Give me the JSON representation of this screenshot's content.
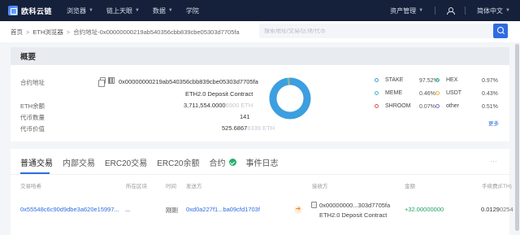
{
  "nav": {
    "logo": "欧科云链",
    "items": [
      "浏览器",
      "链上天眼",
      "数据",
      "学院"
    ],
    "asset_mgmt": "资产管理",
    "language": "简体中文"
  },
  "breadcrumb": {
    "home": "首页",
    "explorer": "ETH浏览器",
    "current": "合约地址-0x00000000219ab540356cbb839cbe05303d7705fa"
  },
  "search": {
    "placeholder": "搜索地址/交易/区块/代币"
  },
  "overview": {
    "title": "概要",
    "contract_label": "合约地址",
    "contract_address": "0x00000000219ab540356cbb839cbe05303d7705fa",
    "contract_name": "ETH2.0 Deposit Contract",
    "balance_label": "ETH余额",
    "balance_main": "3,711,554.0000",
    "balance_tail": "6900 ETH",
    "token_count_label": "代币数量",
    "token_count": "141",
    "token_value_label": "代币价值",
    "token_value_main": "525.6867",
    "token_value_tail": "8339 ETH",
    "more": "更多",
    "legend": [
      {
        "name": "STAKE",
        "pct": "97.52%",
        "color": "#3d9ee0"
      },
      {
        "name": "HEX",
        "pct": "0.97%",
        "color": "#2bbfa3"
      },
      {
        "name": "MEME",
        "pct": "0.46%",
        "color": "#3fb8c8"
      },
      {
        "name": "USDT",
        "pct": "0.43%",
        "color": "#f2b233"
      },
      {
        "name": "SHROOM",
        "pct": "0.07%",
        "color": "#e0524a"
      },
      {
        "name": "other",
        "pct": "0.51%",
        "color": "#7a6cd6"
      }
    ]
  },
  "chart_data": {
    "type": "pie",
    "categories": [
      "STAKE",
      "HEX",
      "MEME",
      "USDT",
      "SHROOM",
      "other"
    ],
    "values": [
      97.52,
      0.97,
      0.46,
      0.43,
      0.07,
      0.51
    ],
    "colors": [
      "#3d9ee0",
      "#2bbfa3",
      "#3fb8c8",
      "#f2b233",
      "#e0524a",
      "#7a6cd6"
    ],
    "title": "",
    "legend": "right"
  },
  "tabs": [
    "普通交易",
    "内部交易",
    "ERC20交易",
    "ERC20余额",
    "合约",
    "事件日志"
  ],
  "table": {
    "headers": [
      "交易哈希",
      "所在区块",
      "时间",
      "发送方",
      "接收方",
      "金额",
      "手续费(ETH)"
    ],
    "rows": [
      {
        "hash": "0x55548c6c90d9dbe3a620e15997...",
        "block": "...",
        "time": "刚刚",
        "from": "0xd0a227f1...ba09cfd1703f",
        "to": "0x00000000...303d7705fa",
        "to_name": "ETH2.0 Deposit Contract",
        "amount": "+32.00000000",
        "fee_main": "0.0129",
        "fee_tail": "0254"
      }
    ]
  }
}
